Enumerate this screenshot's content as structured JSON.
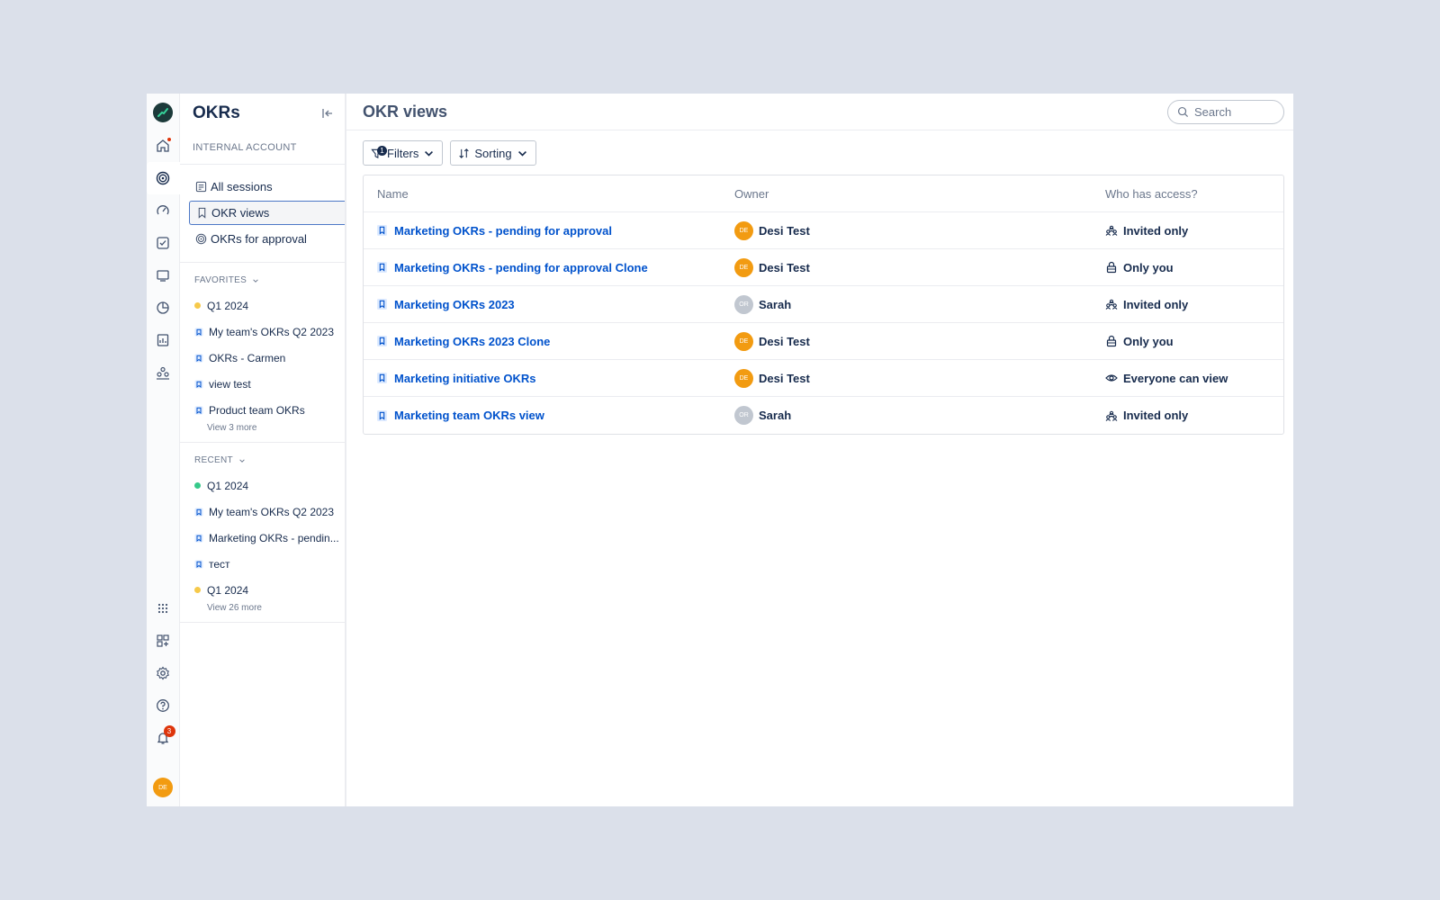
{
  "sidebar": {
    "title": "OKRs",
    "account": "INTERNAL ACCOUNT",
    "nav": [
      {
        "label": "All sessions",
        "icon": "sessions-icon"
      },
      {
        "label": "OKR views",
        "icon": "bookmark-icon",
        "selected": true
      },
      {
        "label": "OKRs for approval",
        "icon": "target-icon"
      }
    ],
    "favorites": {
      "title": "FAVORITES",
      "items": [
        {
          "label": "Q1 2024",
          "kind": "dot",
          "color": "#f6c94a"
        },
        {
          "label": "My team's OKRs Q2 2023",
          "kind": "view"
        },
        {
          "label": "OKRs - Carmen",
          "kind": "view"
        },
        {
          "label": "view test",
          "kind": "view"
        },
        {
          "label": "Product team OKRs",
          "kind": "view"
        }
      ],
      "more": "View 3 more"
    },
    "recent": {
      "title": "RECENT",
      "items": [
        {
          "label": "Q1 2024",
          "kind": "dot",
          "color": "#36c98a"
        },
        {
          "label": "My team's OKRs Q2 2023",
          "kind": "view"
        },
        {
          "label": "Marketing OKRs - pendin...",
          "kind": "view"
        },
        {
          "label": "тест",
          "kind": "view"
        },
        {
          "label": "Q1 2024",
          "kind": "dot",
          "color": "#f6c94a"
        }
      ],
      "more": "View 26 more"
    }
  },
  "rail": {
    "notification_count": "3",
    "user_initials": "DE"
  },
  "main": {
    "title": "OKR views",
    "search_placeholder": "Search",
    "filters_label": "Filters",
    "filters_count": "1",
    "sorting_label": "Sorting",
    "columns": [
      "Name",
      "Owner",
      "Who has access?"
    ],
    "rows": [
      {
        "name": "Marketing OKRs - pending for approval",
        "owner": "Desi Test",
        "initials": "DE",
        "avatar_color": "#f29b11",
        "access": "Invited only",
        "access_icon": "group-icon"
      },
      {
        "name": "Marketing OKRs - pending for approval Clone",
        "owner": "Desi Test",
        "initials": "DE",
        "avatar_color": "#f29b11",
        "access": "Only you",
        "access_icon": "lock-icon"
      },
      {
        "name": "Marketing OKRs 2023",
        "owner": "Sarah",
        "initials": "OR",
        "avatar_color": "#c1c7d0",
        "access": "Invited only",
        "access_icon": "group-icon"
      },
      {
        "name": "Marketing OKRs 2023 Clone",
        "owner": "Desi Test",
        "initials": "DE",
        "avatar_color": "#f29b11",
        "access": "Only you",
        "access_icon": "lock-icon"
      },
      {
        "name": "Marketing initiative OKRs",
        "owner": "Desi Test",
        "initials": "DE",
        "avatar_color": "#f29b11",
        "access": "Everyone can view",
        "access_icon": "eye-icon"
      },
      {
        "name": "Marketing team OKRs view",
        "owner": "Sarah",
        "initials": "OR",
        "avatar_color": "#c1c7d0",
        "access": "Invited only",
        "access_icon": "group-icon"
      }
    ]
  }
}
